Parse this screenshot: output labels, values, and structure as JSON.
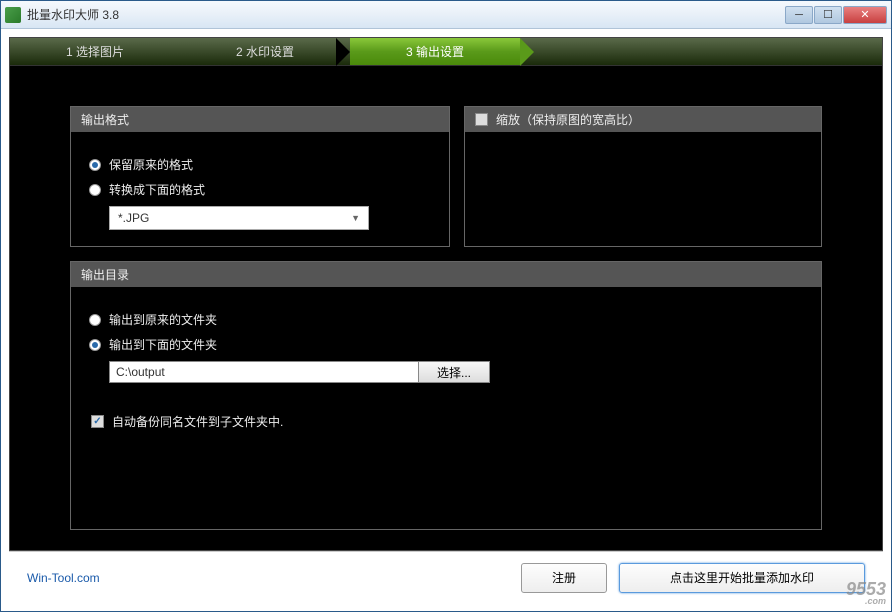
{
  "window": {
    "title": "批量水印大师 3.8"
  },
  "steps": {
    "items": [
      {
        "label": "1 选择图片"
      },
      {
        "label": "2 水印设置"
      },
      {
        "label": "3 输出设置"
      }
    ]
  },
  "format_panel": {
    "title": "输出格式",
    "keep_original": "保留原来的格式",
    "convert_to": "转换成下面的格式",
    "format_value": "*.JPG"
  },
  "scale_panel": {
    "title": "缩放（保持原图的宽高比）"
  },
  "outdir_panel": {
    "title": "输出目录",
    "to_original": "输出到原来的文件夹",
    "to_below": "输出到下面的文件夹",
    "path": "C:\\output",
    "browse": "选择...",
    "backup": "自动备份同名文件到子文件夹中."
  },
  "footer": {
    "link": "Win-Tool.com",
    "register": "注册",
    "start": "点击这里开始批量添加水印"
  },
  "watermark": {
    "site": "9553",
    "sub": ".com"
  }
}
